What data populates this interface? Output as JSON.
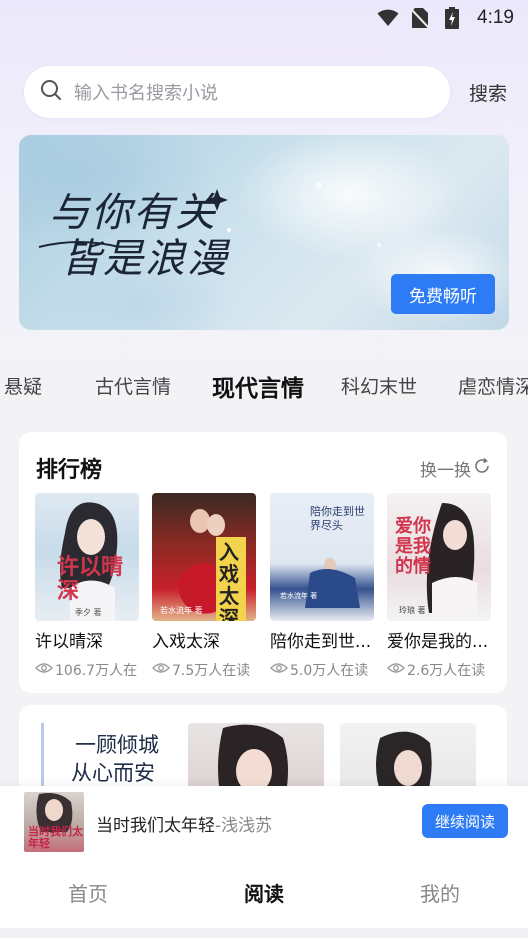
{
  "status_bar": {
    "time": "4:19",
    "icons": [
      "wifi-icon",
      "no-sim-icon",
      "battery-charging-icon"
    ]
  },
  "search": {
    "placeholder": "输入书名搜索小说",
    "button_label": "搜索",
    "icon": "search-icon"
  },
  "banner": {
    "title_line1": "与你有关",
    "title_line2": "皆是浪漫",
    "button_label": "免费畅听"
  },
  "categories": {
    "items": [
      "悬疑",
      "古代言情",
      "现代言情",
      "科幻末世",
      "虐恋情深"
    ],
    "active": "现代言情"
  },
  "ranking": {
    "title": "排行榜",
    "refresh_label": "换一换",
    "books": [
      {
        "name": "许以晴深",
        "readers": "106.7万人在",
        "cover_text": "许以晴深",
        "author_mark": "季夕 著"
      },
      {
        "name": "入戏太深",
        "readers": "7.5万人在读",
        "cover_text": "入戏太深",
        "author_mark": "若水流年 著"
      },
      {
        "name": "陪你走到世...",
        "readers": "5.0万人在读",
        "cover_text": "陪你走到世界尽头",
        "author_mark": "若水流年 著"
      },
      {
        "name": "爱你是我的...",
        "readers": "2.6万人在读",
        "cover_text": "爱你是我的情",
        "author_mark": "玲琅 著"
      }
    ]
  },
  "recommend": {
    "covers": [
      {
        "text_line1": "一顾倾城",
        "text_line2": "从心而安"
      },
      {
        "text_line1": "",
        "text_line2": ""
      },
      {
        "text_line1": "",
        "text_line2": ""
      }
    ]
  },
  "continue_reading": {
    "title": "当时我们太年轻",
    "author": "-浅浅苏",
    "cover_text": "当时我们太年轻",
    "button_label": "继续阅读"
  },
  "bottom_nav": {
    "items": [
      "首页",
      "阅读",
      "我的"
    ],
    "active": "阅读"
  },
  "colors": {
    "accent": "#2d7cf6",
    "background": "#f3f3f6"
  }
}
